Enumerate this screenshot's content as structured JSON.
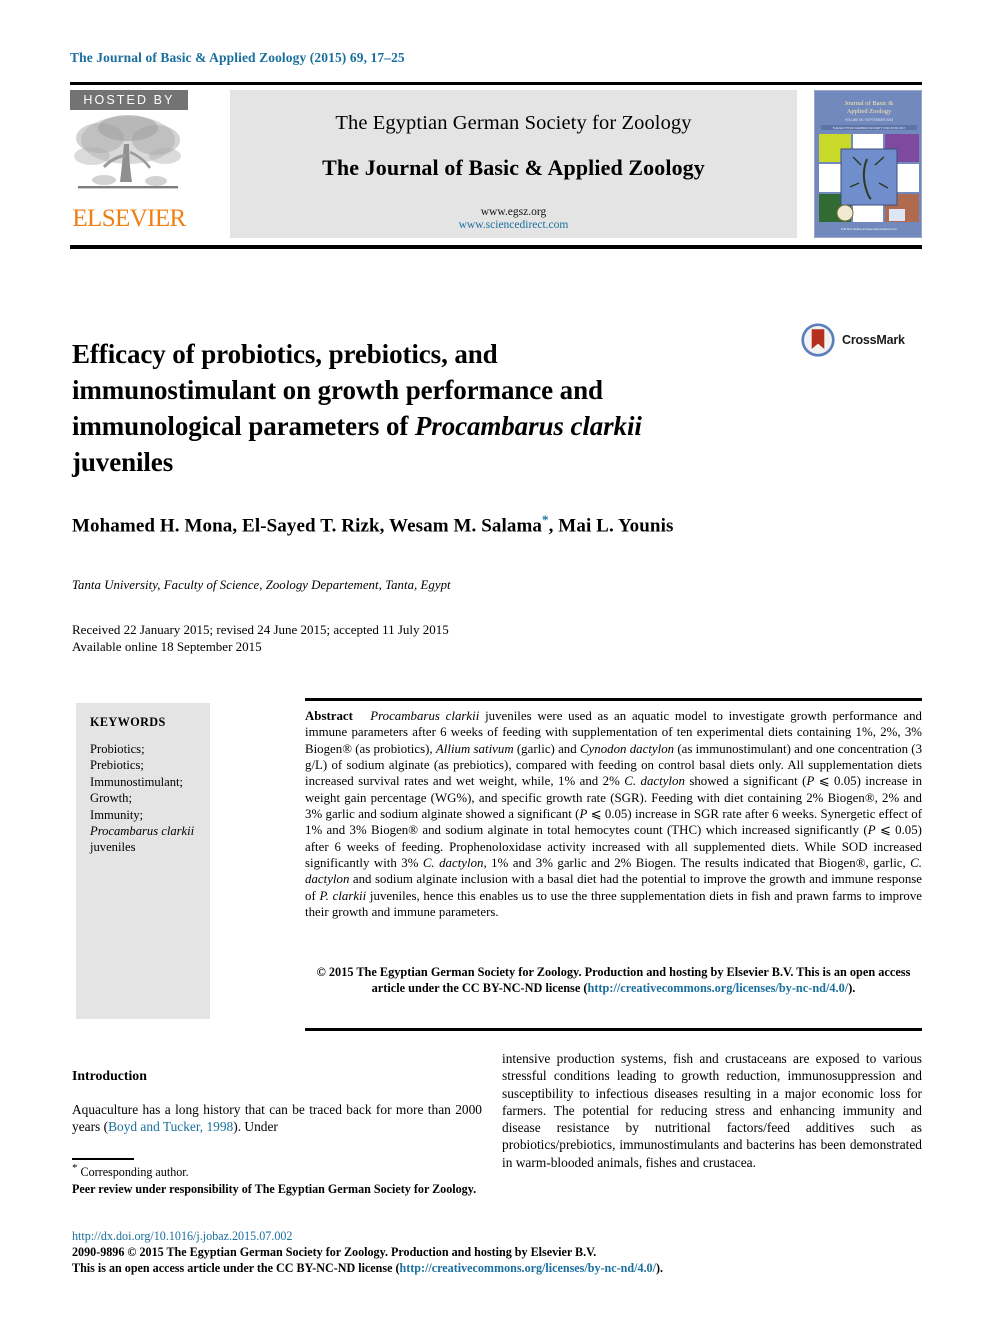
{
  "running_head": "The Journal of Basic & Applied Zoology (2015) 69, 17–25",
  "masthead": {
    "hosted_by": "HOSTED BY",
    "publisher": "ELSEVIER",
    "tree_icon": "elsevier-tree-icon",
    "society": "The Egyptian German Society for Zoology",
    "journal_title": "The Journal of Basic & Applied Zoology",
    "url_society": "www.egsz.org",
    "url_platform": "www.sciencedirect.com",
    "cover_alt": "journal-cover-thumbnail"
  },
  "article": {
    "title_line1": "Efficacy of probiotics, prebiotics, and",
    "title_line2": "immunostimulant on growth performance and",
    "title_line3_pre": "immunological parameters of ",
    "title_line3_italic": "Procambarus clarkii",
    "title_line4": "juveniles",
    "crossmark_label": "CrossMark",
    "authors_pre": "Mohamed H. Mona, El-Sayed T. Rizk, Wesam M. Salama",
    "authors_star": "*",
    "authors_post": ", Mai L. Younis",
    "affiliation": "Tanta University, Faculty of Science, Zoology Departement, Tanta, Egypt",
    "received": "Received 22 January 2015; revised 24 June 2015; accepted 11 July 2015",
    "available": "Available online 18 September 2015"
  },
  "keywords": {
    "heading": "KEYWORDS",
    "items": [
      "Probiotics;",
      "Prebiotics;",
      "Immunostimulant;",
      "Growth;",
      "Immunity;"
    ],
    "last_italic": "Procambarus clarkii",
    "last_plain": " juveniles"
  },
  "abstract": {
    "label": "Abstract",
    "p1_italic1": "Procambarus clarkii",
    "p1_a": " juveniles were used as an aquatic model to investigate growth performance and immune parameters after 6 weeks of feeding with supplementation of ten experimental diets containing 1%, 2%, 3% Biogen® (as probiotics), ",
    "p1_italic2": "Allium sativum",
    "p1_b": " (garlic) and ",
    "p1_italic3": "Cynodon dactylon",
    "p1_c": " (as immunostimulant) and one concentration (3 g/L) of sodium alginate (as prebiotics), compared with feeding on control basal diets only. All supplementation diets increased survival rates and wet weight, while, 1% and 2% ",
    "p1_italic4": "C. dactylon",
    "p1_d": " showed a significant (",
    "p1_italic5": "P",
    "p1_e": " ⩽ 0.05) increase in weight gain percentage (WG%), and specific growth rate (SGR). Feeding with diet containing 2% Biogen®, 2% and 3% garlic and sodium alginate showed a significant (",
    "p1_italic6": "P",
    "p1_f": " ⩽ 0.05) increase in SGR rate after 6 weeks. Synergetic effect of 1% and 3% Biogen® and sodium alginate in total hemocytes count (THC) which increased significantly (",
    "p1_italic7": "P",
    "p1_g": " ⩽ 0.05) after 6 weeks of feeding. Prophenoloxidase activity increased with all supplemented diets. While SOD increased significantly with 3% ",
    "p1_italic8": "C. dactylon",
    "p1_h": ", 1% and 3% garlic and 2% Biogen. The results indicated that Biogen®, garlic, ",
    "p1_italic9": "C. dactylon",
    "p1_i": " and sodium alginate inclusion with a basal diet had the potential to improve the growth and immune response of ",
    "p1_italic10": "P. clarkii",
    "p1_j": " juveniles, hence this enables us to use the three supplementation diets in fish and prawn farms to improve their growth and immune parameters.",
    "copyright_a": "© 2015 The Egyptian German Society for Zoology. Production and hosting by Elsevier B.V. This is an open access article under the CC BY-NC-ND license (",
    "copyright_link": "http://creativecommons.org/licenses/by-nc-nd/4.0/",
    "copyright_b": ")."
  },
  "introduction": {
    "heading": "Introduction",
    "left_a": "Aquaculture has a long history that can be traced back for more than 2000 years (",
    "left_link": "Boyd and Tucker, 1998",
    "left_b": "). Under",
    "right": "intensive production systems, fish and crustaceans are exposed to various stressful conditions leading to growth reduction, immunosuppression and susceptibility to infectious diseases resulting in a major economic loss for farmers. The potential for reducing stress and enhancing immunity and disease resistance by nutritional factors/feed additives such as probiotics/prebiotics, immunostimulants and bacterins has been demonstrated in warm-blooded animals, fishes and crustacea."
  },
  "footnote": {
    "star": "*",
    "corresponding": " Corresponding author.",
    "peer_review": "Peer review under responsibility of The Egyptian German Society for Zoology."
  },
  "footer": {
    "doi": "http://dx.doi.org/10.1016/j.jobaz.2015.07.002",
    "line1": "2090-9896 © 2015 The Egyptian German Society for Zoology. Production and hosting by Elsevier B.V.",
    "line2_a": "This is an open access article under the CC BY-NC-ND license (",
    "line2_link": "http://creativecommons.org/licenses/by-nc-nd/4.0/",
    "line2_b": ")."
  },
  "colors": {
    "link": "#1a6f9e",
    "elsevier_orange": "#f07f12",
    "band_gray": "#e4e4e4",
    "hosted_gray": "#737373"
  }
}
